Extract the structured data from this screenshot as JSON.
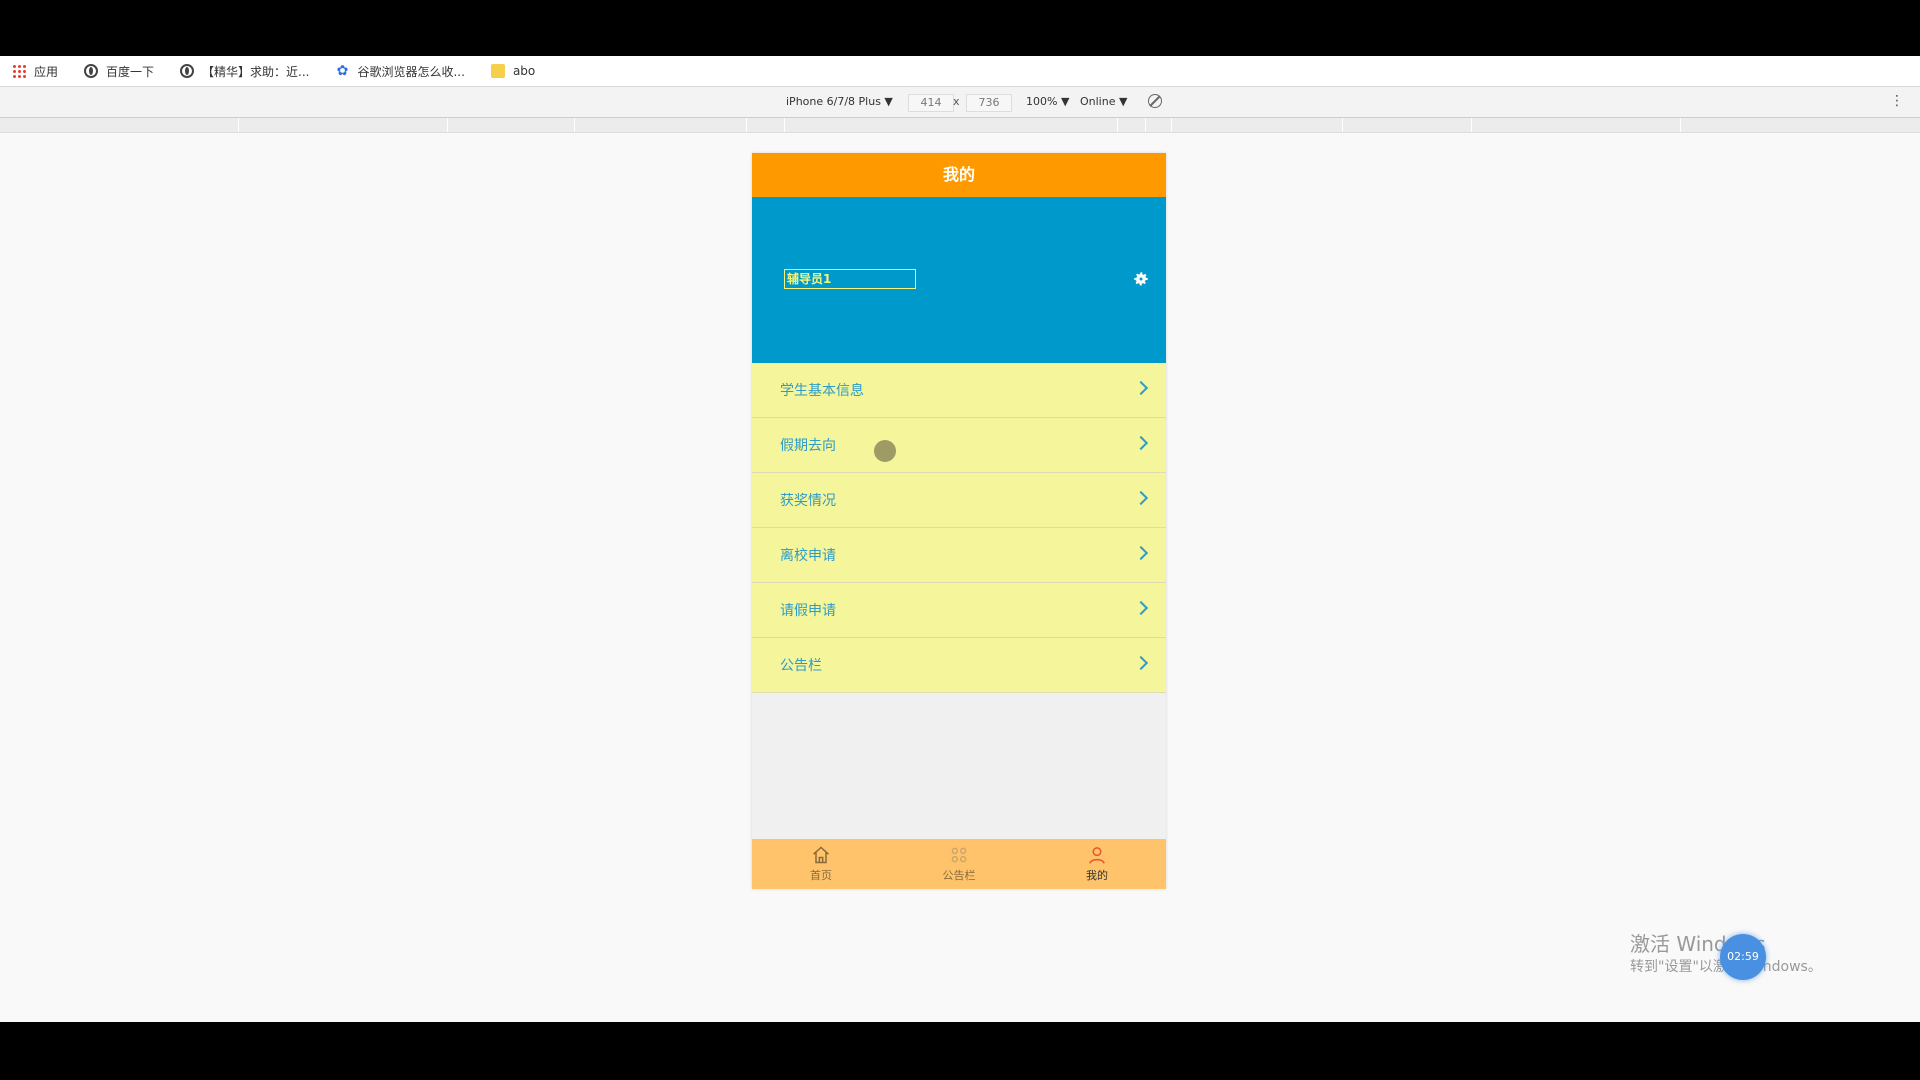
{
  "bookmarks": [
    {
      "icon": "apps-icon",
      "label": "应用"
    },
    {
      "icon": "globe-icon",
      "label": "百度一下"
    },
    {
      "icon": "globe-icon",
      "label": "【精华】求助：近..."
    },
    {
      "icon": "paw-icon",
      "label": "谷歌浏览器怎么收..."
    },
    {
      "icon": "folder-icon",
      "label": "abo"
    }
  ],
  "devtools": {
    "device": "iPhone 6/7/8 Plus ▼",
    "width": "414",
    "times": "x",
    "height": "736",
    "zoom": "100% ▼",
    "network": "Online ▼"
  },
  "app": {
    "title": "我的",
    "username": "辅导员1",
    "menu": [
      {
        "label": "学生基本信息"
      },
      {
        "label": "假期去向"
      },
      {
        "label": "获奖情况"
      },
      {
        "label": "离校申请"
      },
      {
        "label": "请假申请"
      },
      {
        "label": "公告栏"
      }
    ],
    "tabs": [
      {
        "label": "首页",
        "icon": "home-icon"
      },
      {
        "label": "公告栏",
        "icon": "bulletin-icon"
      },
      {
        "label": "我的",
        "icon": "user-icon"
      }
    ],
    "colors": {
      "header": "#ff9900",
      "profile": "#0099cc",
      "menu": "#f5f59c",
      "tabbar": "#ffc36b"
    }
  },
  "watermark": {
    "line1": "激活 Windows",
    "line2": "转到\"设置\"以激活 Windows。",
    "timer": "02:59"
  }
}
